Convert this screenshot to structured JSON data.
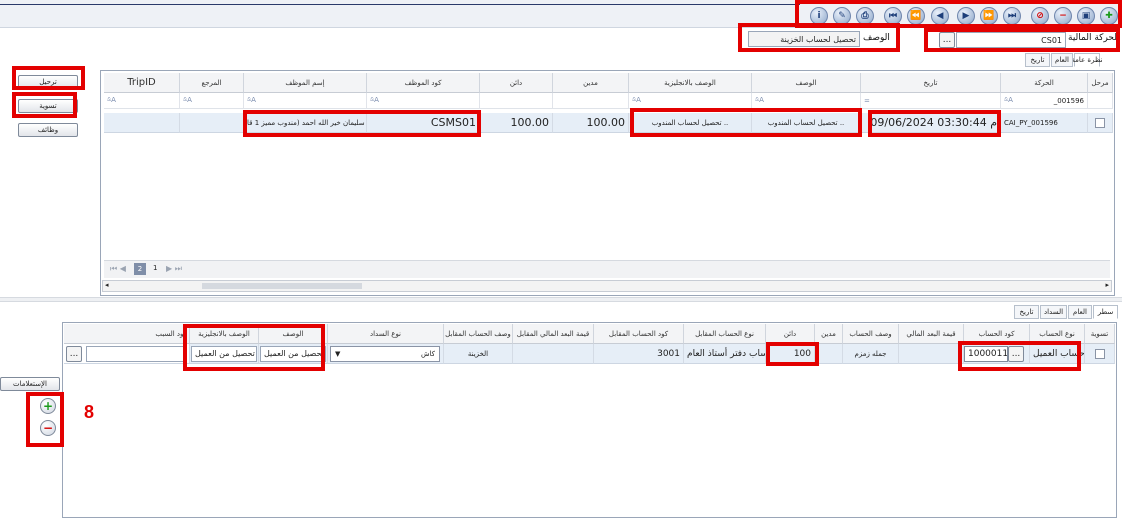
{
  "toolbar": {
    "buttons": [
      {
        "name": "add",
        "glyph": "✚"
      },
      {
        "name": "save",
        "glyph": "▣"
      },
      {
        "name": "remove",
        "glyph": "−"
      },
      {
        "name": "cancel",
        "glyph": "⊘"
      },
      {
        "name": "last",
        "glyph": "⏭"
      },
      {
        "name": "next-page",
        "glyph": "⏩"
      },
      {
        "name": "next",
        "glyph": "▶"
      },
      {
        "name": "previous",
        "glyph": "◀"
      },
      {
        "name": "previous-page",
        "glyph": "⏪"
      },
      {
        "name": "first",
        "glyph": "⏮"
      },
      {
        "name": "print",
        "glyph": "⎙"
      },
      {
        "name": "attach",
        "glyph": "✎"
      },
      {
        "name": "info",
        "glyph": "i"
      }
    ]
  },
  "header": {
    "transaction_type_label": "نوع الحركة المالية",
    "transaction_type_value": "CS01",
    "ellipsis": "...",
    "description_label": "الوصف",
    "description_value": "تحصيل لحساب الخزينة"
  },
  "top_tabs": [
    "نظرة عامة",
    "العام",
    "تاريخ"
  ],
  "top_grid": {
    "columns": [
      "مرحل",
      "الحركة",
      "تاريخ",
      "الوصف",
      "الوصف بالانجليزية",
      "مدين",
      "دائن",
      "كود الموظف",
      "إسم الموظف",
      "المرجع",
      "TripID"
    ],
    "filter_icon": "⩯A",
    "filter_value_movement": "_001596",
    "filter_eq": "=",
    "row": {
      "movement": "CAI_PY_001596",
      "date": "09/06/2024 03:30:44 م",
      "description": "تحصيل لحساب المندوب ..",
      "description_en": "تحصيل لحساب المندوب ..",
      "debit": "100.00",
      "credit": "100.00",
      "employee_code": "CSMS01",
      "employee_name": "سليمان خير الله احمد  (مندوب مميز 1 قا"
    },
    "pager": {
      "pages": [
        "2",
        "1"
      ]
    }
  },
  "side_buttons": {
    "post": "ترحيل",
    "settle": "تسوية",
    "functions": "وظائف"
  },
  "bottom_tabs": [
    "سطر",
    "العام",
    "السداد",
    "تاريخ"
  ],
  "bottom_grid": {
    "columns": [
      "تسوية",
      "نوع الحساب",
      "كود الحساب",
      "قيمة البعد المالي",
      "وصف الحساب",
      "مدين",
      "دائن",
      "نوع الحساب المقابل",
      "كود الحساب المقابل",
      "قيمة البعد المالي المقابل",
      "وصف الحساب المقابل",
      "نوع السداد",
      "الوصف",
      "الوصف بالانجليزية",
      "كود السبب"
    ],
    "row": {
      "account_type": "حساب العميل",
      "account_code": "1000011",
      "dimension_value": "جمله زمزم",
      "credit": "100",
      "offset_account_type": "حساب دفتر أستاذ العام",
      "offset_account_code": "3001",
      "offset_account_desc": "الخزينة",
      "payment_type": "كاش",
      "description": "تحصيل من العميل ....",
      "description_en": "تحصيل من العميل ...."
    }
  },
  "left_panel": {
    "lookups": "الإستعلامات",
    "add": "+",
    "remove": "−"
  },
  "annotation_number": "8"
}
